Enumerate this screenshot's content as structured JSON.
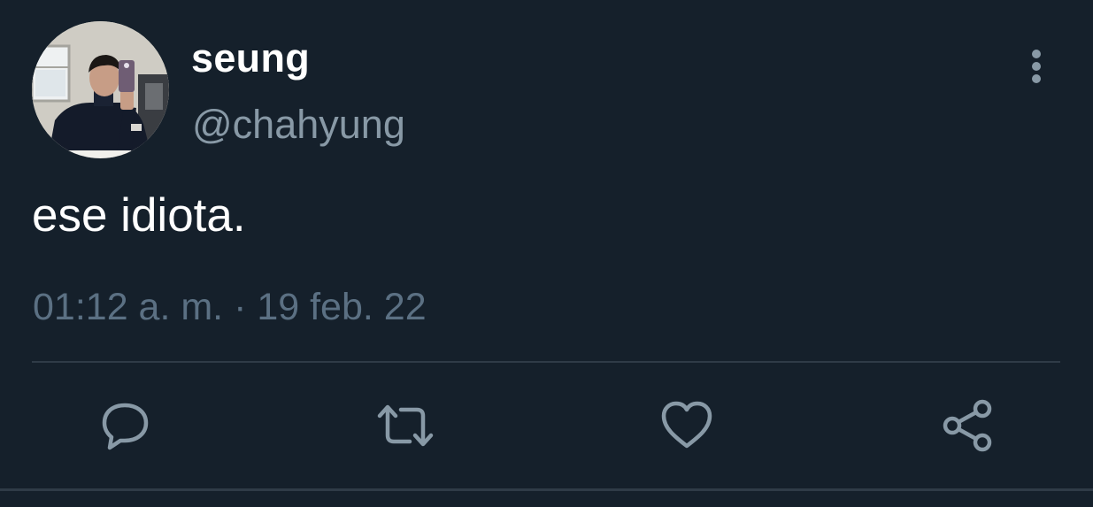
{
  "tweet": {
    "display_name": "seung",
    "handle": "@chahyung",
    "text": "ese idiota.",
    "timestamp": "01:12 a. m. · 19 feb. 22"
  },
  "actions": [
    {
      "name": "reply",
      "icon": "reply-icon"
    },
    {
      "name": "retweet",
      "icon": "retweet-icon"
    },
    {
      "name": "like",
      "icon": "heart-icon"
    },
    {
      "name": "share",
      "icon": "share-icon"
    }
  ],
  "colors": {
    "background": "#15202b",
    "primary_text": "#ffffff",
    "secondary_text": "#8899a6",
    "timestamp_text": "#5b7083",
    "divider": "#2f3b47",
    "icon": "#8899a6"
  }
}
